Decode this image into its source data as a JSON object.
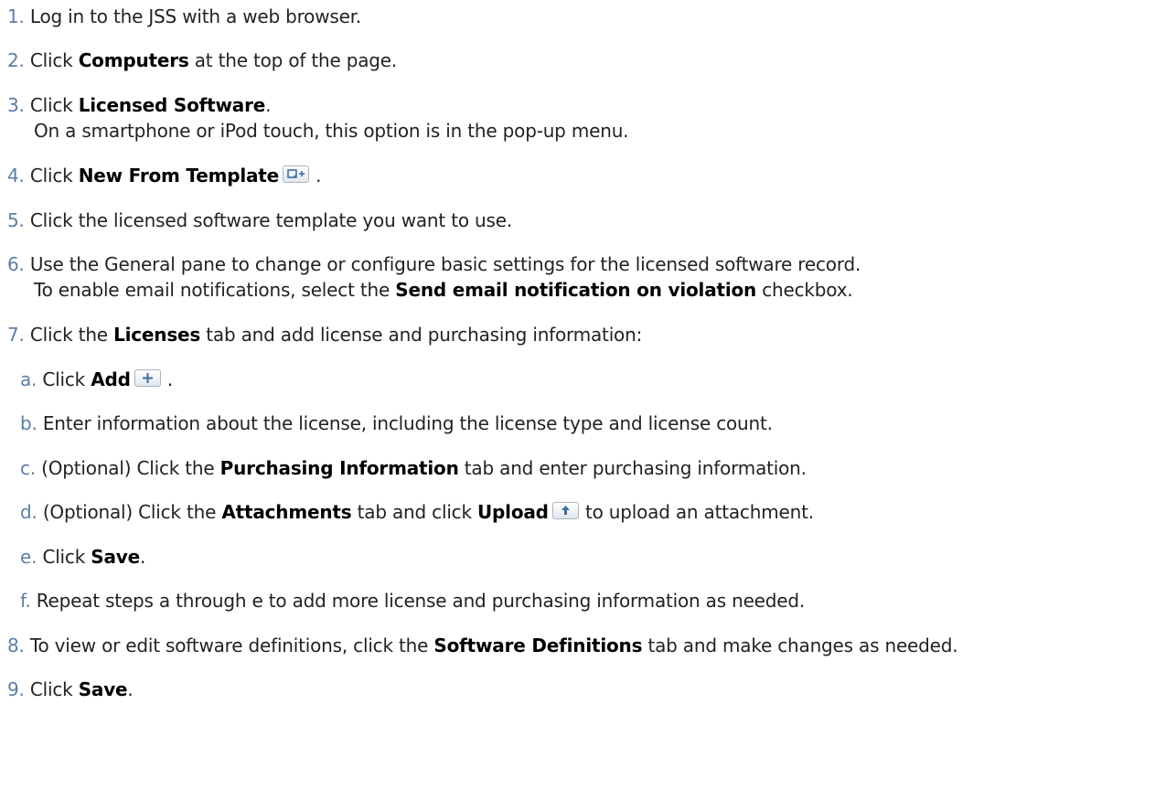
{
  "steps": [
    {
      "num": "1.",
      "text": "Log in to the JSS with a web browser."
    },
    {
      "num": "2.",
      "pre": "Click ",
      "bold": "Computers",
      "post": " at the top of the page."
    },
    {
      "num": "3.",
      "pre": "Click ",
      "bold": "Licensed Software",
      "post": ".",
      "note": "On a smartphone or iPod touch, this option is in the pop-up menu."
    },
    {
      "num": "4.",
      "pre": "Click ",
      "bold": "New From Template",
      "post": " ."
    },
    {
      "num": "5.",
      "text": "Click the licensed software template you want to use."
    },
    {
      "num": "6.",
      "text": "Use the General pane to change or configure basic settings for the licensed software record.",
      "note_pre": "To enable email notifications, select the ",
      "note_bold": "Send email notification on violation",
      "note_post": " checkbox."
    },
    {
      "num": "7.",
      "pre": "Click the ",
      "bold": "Licenses",
      "post": " tab and add license and purchasing information:"
    },
    {
      "num": "8.",
      "pre": "To view or edit software definitions, click the ",
      "bold": "Software Definitions",
      "post": " tab and make changes as needed."
    },
    {
      "num": "9.",
      "pre": "Click ",
      "bold": "Save",
      "post": "."
    }
  ],
  "substeps": [
    {
      "num": "a.",
      "pre": "Click ",
      "bold": "Add",
      "post": " ."
    },
    {
      "num": "b.",
      "text": "Enter information about the license, including the license type and license count."
    },
    {
      "num": "c.",
      "pre": "(Optional) Click the ",
      "bold": "Purchasing Information",
      "post": " tab and enter purchasing information."
    },
    {
      "num": "d.",
      "pre": "(Optional) Click the ",
      "bold": "Attachments",
      "post": " tab and click ",
      "bold2": "Upload",
      "post2": " to upload an attachment."
    },
    {
      "num": "e.",
      "pre": "Click ",
      "bold": "Save",
      "post": "."
    },
    {
      "num": "f.",
      "text": "Repeat steps a through e to add more license and purchasing information as needed."
    }
  ],
  "icons": {
    "template": "new-from-template-icon",
    "add": "add-plus-icon",
    "upload": "upload-arrow-icon"
  },
  "colors": {
    "list_number": "#5a7fa6",
    "icon_glyph": "#3b6ea5"
  }
}
